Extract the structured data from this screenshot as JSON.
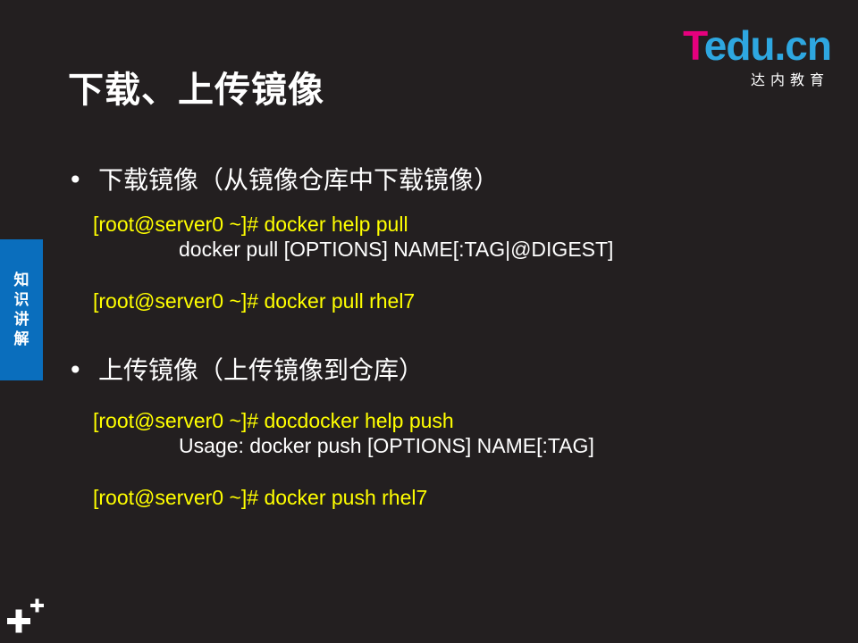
{
  "slide": {
    "title": "下载、上传镜像"
  },
  "logo": {
    "main_t": "T",
    "main_rest": "edu.cn",
    "sub": "达内教育"
  },
  "side_tab": {
    "chars": [
      "知",
      "识",
      "讲",
      "解"
    ]
  },
  "bullets": [
    {
      "text": "下载镜像（从镜像仓库中下载镜像）",
      "code_lines": [
        "[root@server0 ~]# docker  help pull",
        "docker pull [OPTIONS] NAME[:TAG|@DIGEST]",
        "[root@server0 ~]# docker  pull  rhel7"
      ]
    },
    {
      "text": "上传镜像（上传镜像到仓库）",
      "code_lines": [
        "[root@server0 ~]# docdocker help push",
        "Usage:   docker push [OPTIONS] NAME[:TAG]",
        "[root@server0 ~]# docker  push  rhel7"
      ]
    }
  ],
  "colors": {
    "background": "#231f20",
    "code_prompt": "#ffff00",
    "side_tab": "#0a6ebd",
    "logo_pink": "#e6007e",
    "logo_blue": "#2ea7e0"
  }
}
